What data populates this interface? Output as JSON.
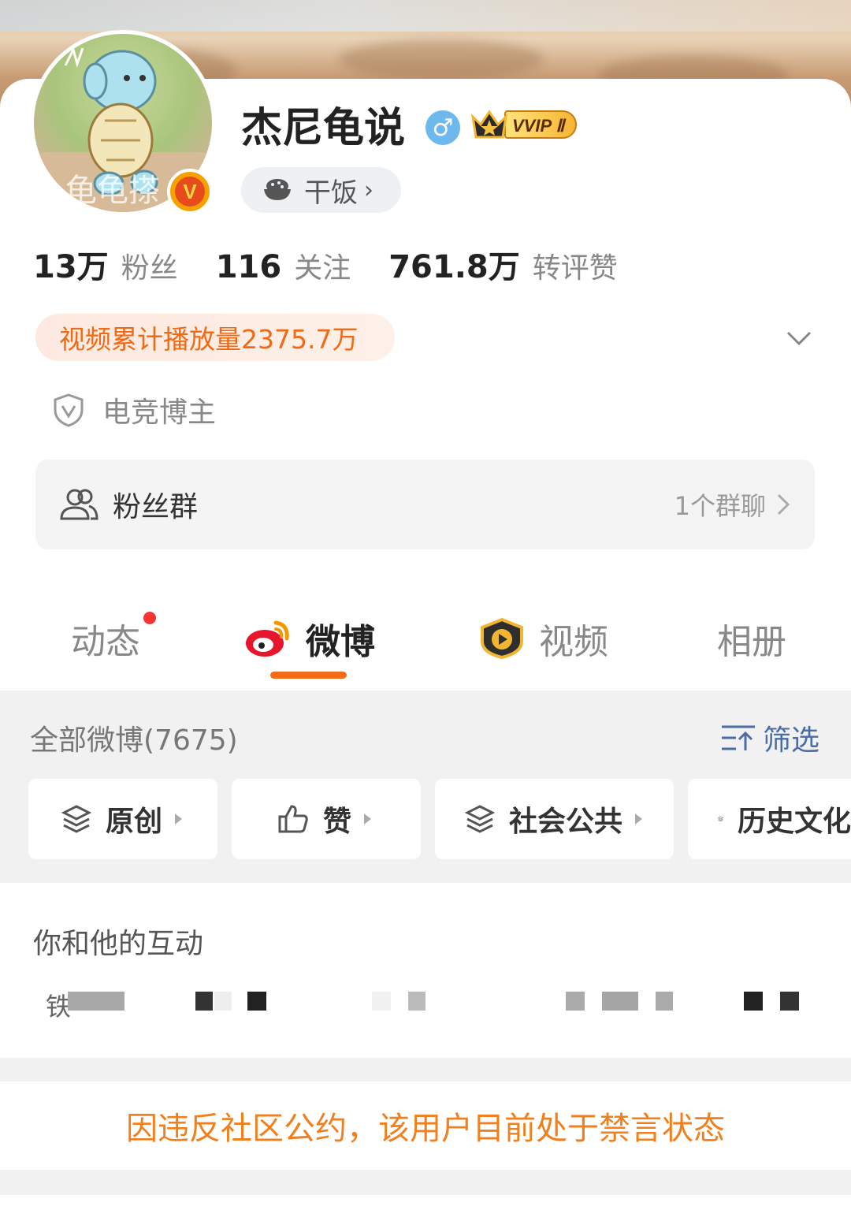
{
  "profile": {
    "name": "杰尼龟说",
    "avatar_watermark": "龟龟搽",
    "verified_badge": "V",
    "gender_symbol": "♂",
    "vip_label": "VVIP Ⅱ",
    "tag": {
      "label": "干饭",
      "chevron": "›"
    }
  },
  "stats": [
    {
      "value": "13万",
      "label": "粉丝"
    },
    {
      "value": "116",
      "label": "关注"
    },
    {
      "value": "761.8万",
      "label": "转评赞"
    }
  ],
  "video_plays": "视频累计播放量2375.7万",
  "role": "电竞博主",
  "fans_group": {
    "label": "粉丝群",
    "count": "1个群聊"
  },
  "tabs": [
    {
      "label": "动态",
      "has_dot": true
    },
    {
      "label": "微博",
      "active": true
    },
    {
      "label": "视频"
    },
    {
      "label": "相册"
    }
  ],
  "posts": {
    "all_label": "全部微博(7675)",
    "filter_label": "筛选",
    "chips": [
      "原创",
      "赞",
      "社会公共",
      "历史文化"
    ]
  },
  "interaction": {
    "title": "你和他的互动",
    "first_char": "铁"
  },
  "banned_notice": "因违反社区公约，该用户目前处于禁言状态",
  "colors": {
    "accent_orange": "#f46b15",
    "notice_orange": "#f07f1e",
    "link_blue": "#4a6da8",
    "dot_red": "#f43530"
  }
}
